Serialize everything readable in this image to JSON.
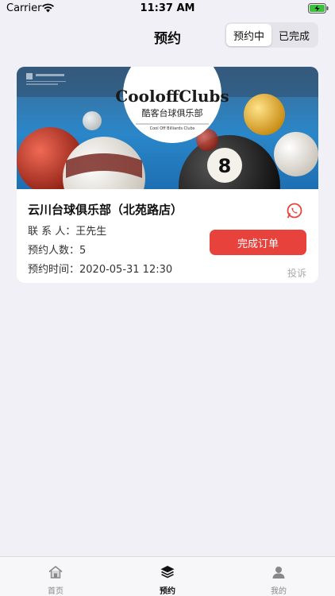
{
  "status_bar": {
    "carrier": "Carrier",
    "time": "11:37 AM",
    "icons": [
      "wifi-icon",
      "battery-charging-icon"
    ]
  },
  "nav": {
    "title": "预约",
    "segments": [
      {
        "label": "预约中",
        "active": true
      },
      {
        "label": "已完成",
        "active": false
      }
    ]
  },
  "booking": {
    "image_logo_text": "CooloffClubs",
    "image_logo_subtitle": "酷客台球俱乐部",
    "image_logo_small": "Cool Off Billiards Clubs",
    "venue_name": "云川台球俱乐部（北苑路店）",
    "contact": "联 系 人：王先生",
    "people": "预约人数：5",
    "time": "预约时间：2020-05-31 12:30",
    "complete_button": "完成订单",
    "complain_link": "投诉"
  },
  "tab_bar": {
    "items": [
      {
        "label": "首页",
        "icon": "home-icon",
        "active": false
      },
      {
        "label": "预约",
        "icon": "layers-icon",
        "active": true
      },
      {
        "label": "我的",
        "icon": "person-icon",
        "active": false
      }
    ]
  },
  "colors": {
    "accent": "#e8423c",
    "background": "#f0f0f6"
  }
}
